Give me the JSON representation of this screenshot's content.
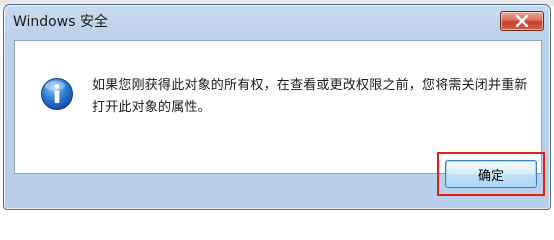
{
  "dialog": {
    "title": "Windows 安全",
    "close_icon": "close-icon",
    "info_icon": "info-icon",
    "message": "如果您刚获得此对象的所有权，在查看或更改权限之前，您将需关闭并重新打开此对象的属性。",
    "ok_label": "确定"
  },
  "colors": {
    "highlight": "#e0201a",
    "close_button": "#c4412b",
    "ok_button": "#bfe1f8"
  }
}
